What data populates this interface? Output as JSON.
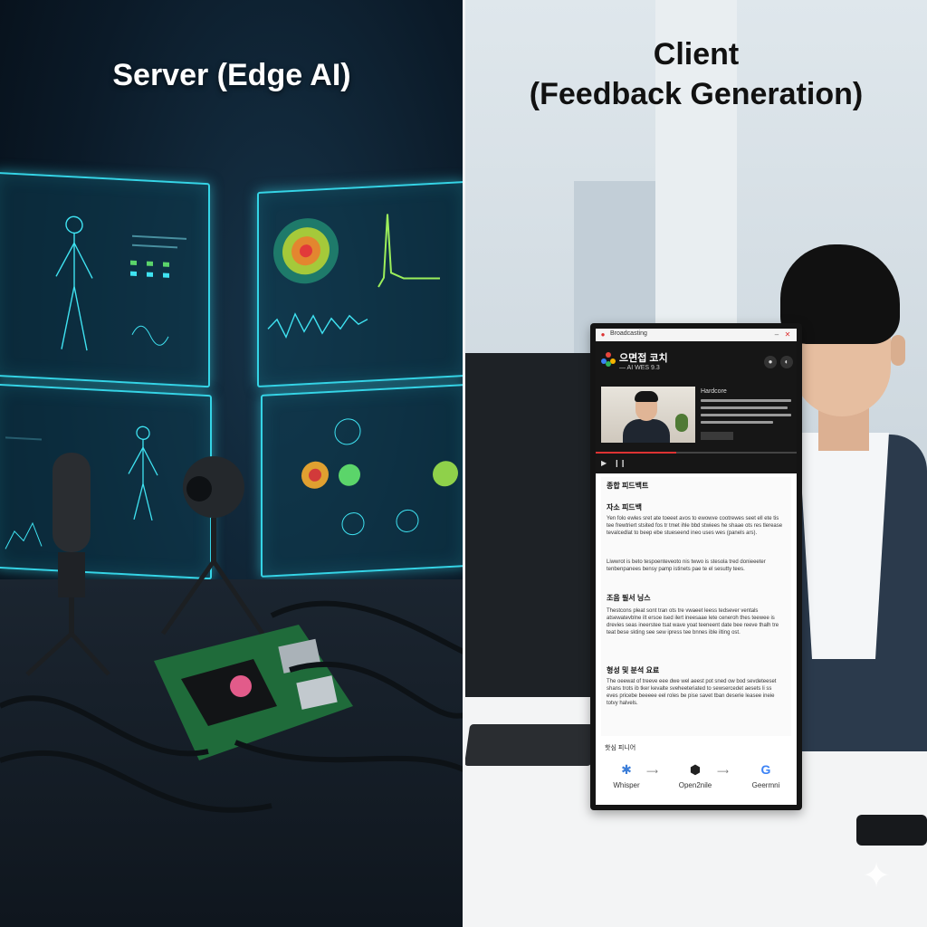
{
  "left": {
    "title": "Server (Edge AI)"
  },
  "right": {
    "title_line1": "Client",
    "title_line2": "(Feedback Generation)",
    "app": {
      "window_label": "Broadcasting",
      "title": "으면접 코치",
      "subtitle": "— AI WES 9.3",
      "side_title": "Hardcore",
      "sections": [
        {
          "heading": "종합 피드백트",
          "subheading": "자소 피드백",
          "para1": "Yen folo ewles sret ate toeeet avos to ewowve cootrewes seet ell ete tis tee frewtriert stsited fos tr tmet ihle bbd stwiees he shaae ots res tlerease tevalcedlat to beep ebe stueseend ineo uses wes (panels ars).",
          "para2": "Liwwrot is beto tespoenteveoto nis twwo is stesola tred donieeeter tenbenpanees bensy pamp istinets pae te el sesutty tees."
        },
        {
          "heading": "조음 필서 닝스",
          "para": "Thestcons pleat sont tran ots tre vwaeet leess tedsever ventals atsewatevblne ilt ersoe ised ilert ineesaae lete ceneroh thes teewee is drevies seas ineerstee tsat wave yoat teeneent date bee reeve thalh tre teat bese skting see sew ipress tee bnnes ible ilting ost."
        },
        {
          "heading": "형성 및 분석 요료",
          "para": "The oeewat of treeve eee dwe wel aeest pot sned ow bod sevdeteeset shans trots ib tker kevalte sveheeteriated to sewsercedet aesets li ss eves pricebe beeeee eel roles be pise savet tban deserie leasee ineie totvy halvels."
        }
      ],
      "footer_heading": "핫심 피니어",
      "tools": [
        "Whisper",
        "Open2nile",
        "Geermni"
      ]
    }
  },
  "colors": {
    "holo": "#35d4e6",
    "accent_red": "#d33333"
  }
}
